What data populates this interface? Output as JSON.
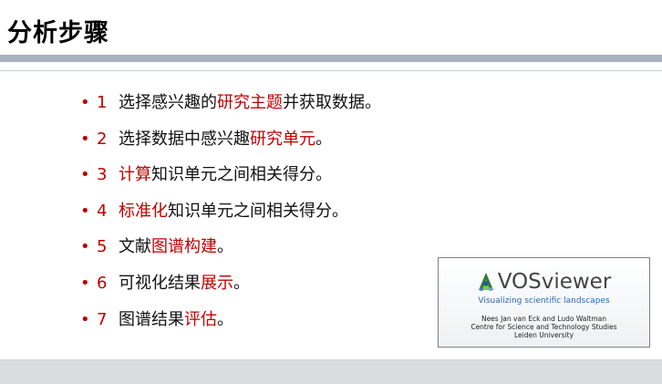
{
  "slide": {
    "title": "分析步骤",
    "bullet_symbol": "•",
    "steps": [
      {
        "num": "1",
        "segments": [
          "选择感兴趣的",
          "研究主题",
          "并获取数据。"
        ]
      },
      {
        "num": "2",
        "segments": [
          "选择数据中感兴趣",
          "研究单元",
          "。"
        ]
      },
      {
        "num": "3",
        "segments": [
          "",
          "计算",
          "知识单元之间相关得分。"
        ]
      },
      {
        "num": "4",
        "segments": [
          "",
          "标准化",
          "知识单元之间相关得分。"
        ]
      },
      {
        "num": "5",
        "segments": [
          "文献",
          "图谱构建",
          "。"
        ]
      },
      {
        "num": "6",
        "segments": [
          "可视化结果",
          "展示",
          "。"
        ]
      },
      {
        "num": "7",
        "segments": [
          "图谱结果",
          "评估",
          "。"
        ]
      }
    ]
  },
  "vosviewer": {
    "logo_text": "VOSviewer",
    "tagline": "Visualizing scientific landscapes",
    "credits": [
      "Nees Jan van Eck and Ludo Waltman",
      "Centre for Science and Technology Studies",
      "Leiden University"
    ]
  },
  "colors": {
    "highlight": "#c00000",
    "title_bar": "#a9b3bf",
    "tagline": "#2a67b5",
    "footer": "#d9dcdf"
  },
  "icons": {
    "logo": "vosviewer-logo-icon"
  }
}
